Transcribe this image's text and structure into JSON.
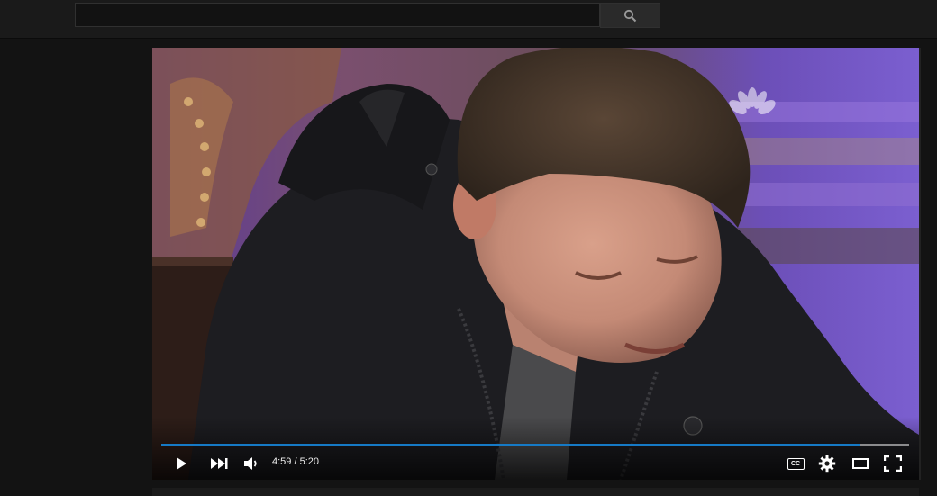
{
  "search": {
    "value": "",
    "placeholder": ""
  },
  "icons": {
    "search": "search-icon",
    "logo": "nbc-peacock-logo",
    "play": "play-icon",
    "next": "next-icon",
    "volume": "volume-icon",
    "captions": "captions-icon",
    "settings": "gear-icon",
    "theater": "theater-mode-icon",
    "fullscreen": "fullscreen-icon"
  },
  "player": {
    "current_time": "4:59",
    "separator": " / ",
    "duration": "5:20",
    "played_fraction": 0.935,
    "loaded_fraction": 1.0,
    "captions_label": "CC"
  },
  "colors": {
    "progress": "#167ac6",
    "background": "#131313",
    "topbar": "#1a1a1a"
  }
}
